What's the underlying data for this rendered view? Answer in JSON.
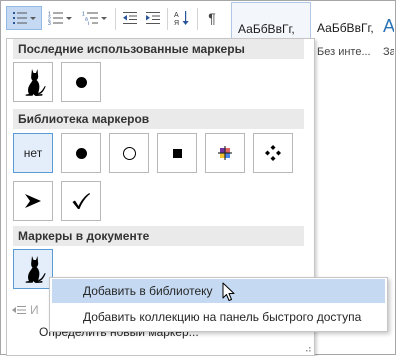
{
  "ribbon": {
    "icons": {
      "bullets": "bulleted-list-icon",
      "numbering": "numbered-list-icon",
      "multilevel": "multilevel-list-icon",
      "decrease_indent": "decrease-indent-icon",
      "increase_indent": "increase-indent-icon",
      "sort": "sort-icon",
      "pilcrow": "show-formatting-marks-icon"
    },
    "pilcrow_glyph": "¶",
    "styles": [
      {
        "sample": "АаБбВвГг,",
        "name": ""
      },
      {
        "sample": "АаБбВвГг,",
        "name": "Без инте..."
      },
      {
        "sample": "А",
        "name": "За"
      }
    ]
  },
  "panel": {
    "recent_header": "Последние использованные маркеры",
    "library_header": "Библиотека маркеров",
    "document_header": "Маркеры в документе",
    "none_label": "нет",
    "recent_items": [
      "cat-bullet-icon",
      "filled-circle-bullet-icon"
    ],
    "library_items": [
      "none",
      "filled-circle-bullet-icon",
      "open-circle-bullet-icon",
      "filled-square-bullet-icon",
      "four-color-square-bullet-icon",
      "four-diamond-bullet-icon",
      "arrowhead-bullet-icon",
      "checkmark-bullet-icon"
    ],
    "document_items": [
      "cat-bullet-icon"
    ],
    "commands": {
      "change_level": "И",
      "define_new": "Определить новый маркер..."
    }
  },
  "context_menu": {
    "items": [
      {
        "label": "Добавить в библиотеку",
        "hover": true
      },
      {
        "label": "Добавить коллекцию на панель быстрого доступа",
        "hover": false
      }
    ]
  },
  "colors": {
    "accent_hover": "#c5daf2",
    "accent_border": "#5b9bd5",
    "section_header_bg": "#eaeaea"
  }
}
